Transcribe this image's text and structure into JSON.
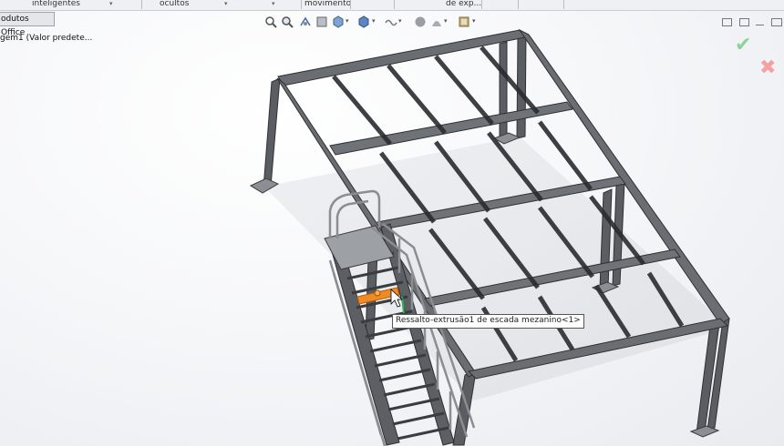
{
  "toolbar_strip": {
    "items": [
      "inteligentes",
      "ocultos",
      "movimento",
      "de exp..."
    ]
  },
  "tab": {
    "label": "odutos Office"
  },
  "feature_tree": {
    "item": "gem1  (Valor predete..."
  },
  "heads_up_view": {
    "icons": [
      "zoom-to-fit-icon",
      "zoom-area-icon",
      "previous-view-icon",
      "section-view-icon",
      "view-orientation-icon",
      "display-style-icon",
      "hide-show-icon",
      "edit-appearance-icon",
      "apply-scene-icon",
      "view-settings-icon"
    ]
  },
  "confirm": {
    "ok": "✔",
    "cancel": "✖"
  },
  "tooltip": {
    "text": "Ressalto-extrusão1 de escada mezanino<1>"
  },
  "colors": {
    "steel": "#5a5d62",
    "steel_dark": "#3a3c40",
    "highlight": "#f08a24",
    "tooltip_border": "#555555"
  }
}
